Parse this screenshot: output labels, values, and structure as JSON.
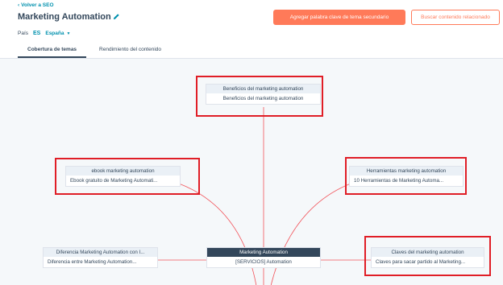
{
  "header": {
    "back_label": "Volver a SEO",
    "title": "Marketing Automation",
    "country_label": "País",
    "country_code": "ES",
    "country_name": "España",
    "primary_button": "Agregar palabra clave de tema secundario",
    "secondary_button": "Buscar contenido relacionado"
  },
  "tabs": [
    {
      "label": "Cobertura de temas",
      "active": true
    },
    {
      "label": "Rendimiento del contenido",
      "active": false
    }
  ],
  "nodes": {
    "top": {
      "title": "Beneficios del marketing automation",
      "body": "Beneficios del marketing automation"
    },
    "left": {
      "title": "ebook marketing automation",
      "body": "Ebook gratuito de Marketing Automati..."
    },
    "right": {
      "title": "Herramientas marketing automation",
      "body": "10 Herramientas de Marketing Automa..."
    },
    "bottom_left": {
      "title": "Diferencia Marketing Automation con I...",
      "body": "Diferencia entre Marketing Automation..."
    },
    "pillar": {
      "title": "Marketing Automation",
      "body": "[SERVICIOS] Automation"
    },
    "bottom_right": {
      "title": "Claves del marketing automation",
      "body": "Claves para sacar partido al Marketing..."
    }
  },
  "colors": {
    "accent": "#ff7a59",
    "link": "#0091ae",
    "connector": "#f2545b",
    "highlight": "#e01e26"
  }
}
